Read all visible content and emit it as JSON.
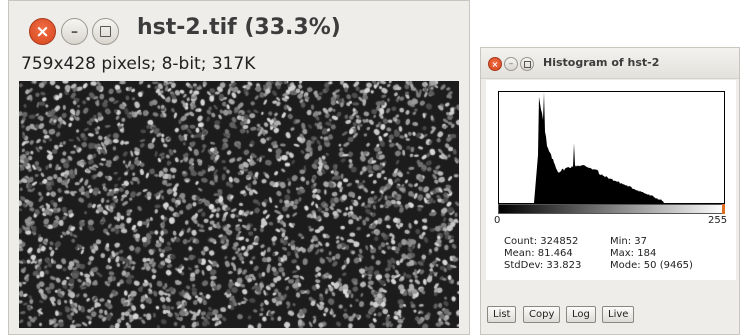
{
  "image_window": {
    "title": "hst-2.tif (33.3%)",
    "info": "759x428 pixels; 8-bit; 317K"
  },
  "histogram_window": {
    "title": "Histogram of hst-2",
    "axis_min": "0",
    "axis_max": "255",
    "stats": {
      "count": "Count: 324852",
      "mean": "Mean: 81.464",
      "stddev": "StdDev: 33.823",
      "min": "Min: 37",
      "max": "Max: 184",
      "mode": "Mode: 50 (9465)"
    },
    "buttons": [
      "List",
      "Copy",
      "Log",
      "Live"
    ]
  },
  "colors": {
    "close_button": "#e0532a",
    "ramp_end_marker": "#e07020"
  },
  "icons": [
    "close-icon",
    "minimize-icon",
    "maximize-icon"
  ]
}
